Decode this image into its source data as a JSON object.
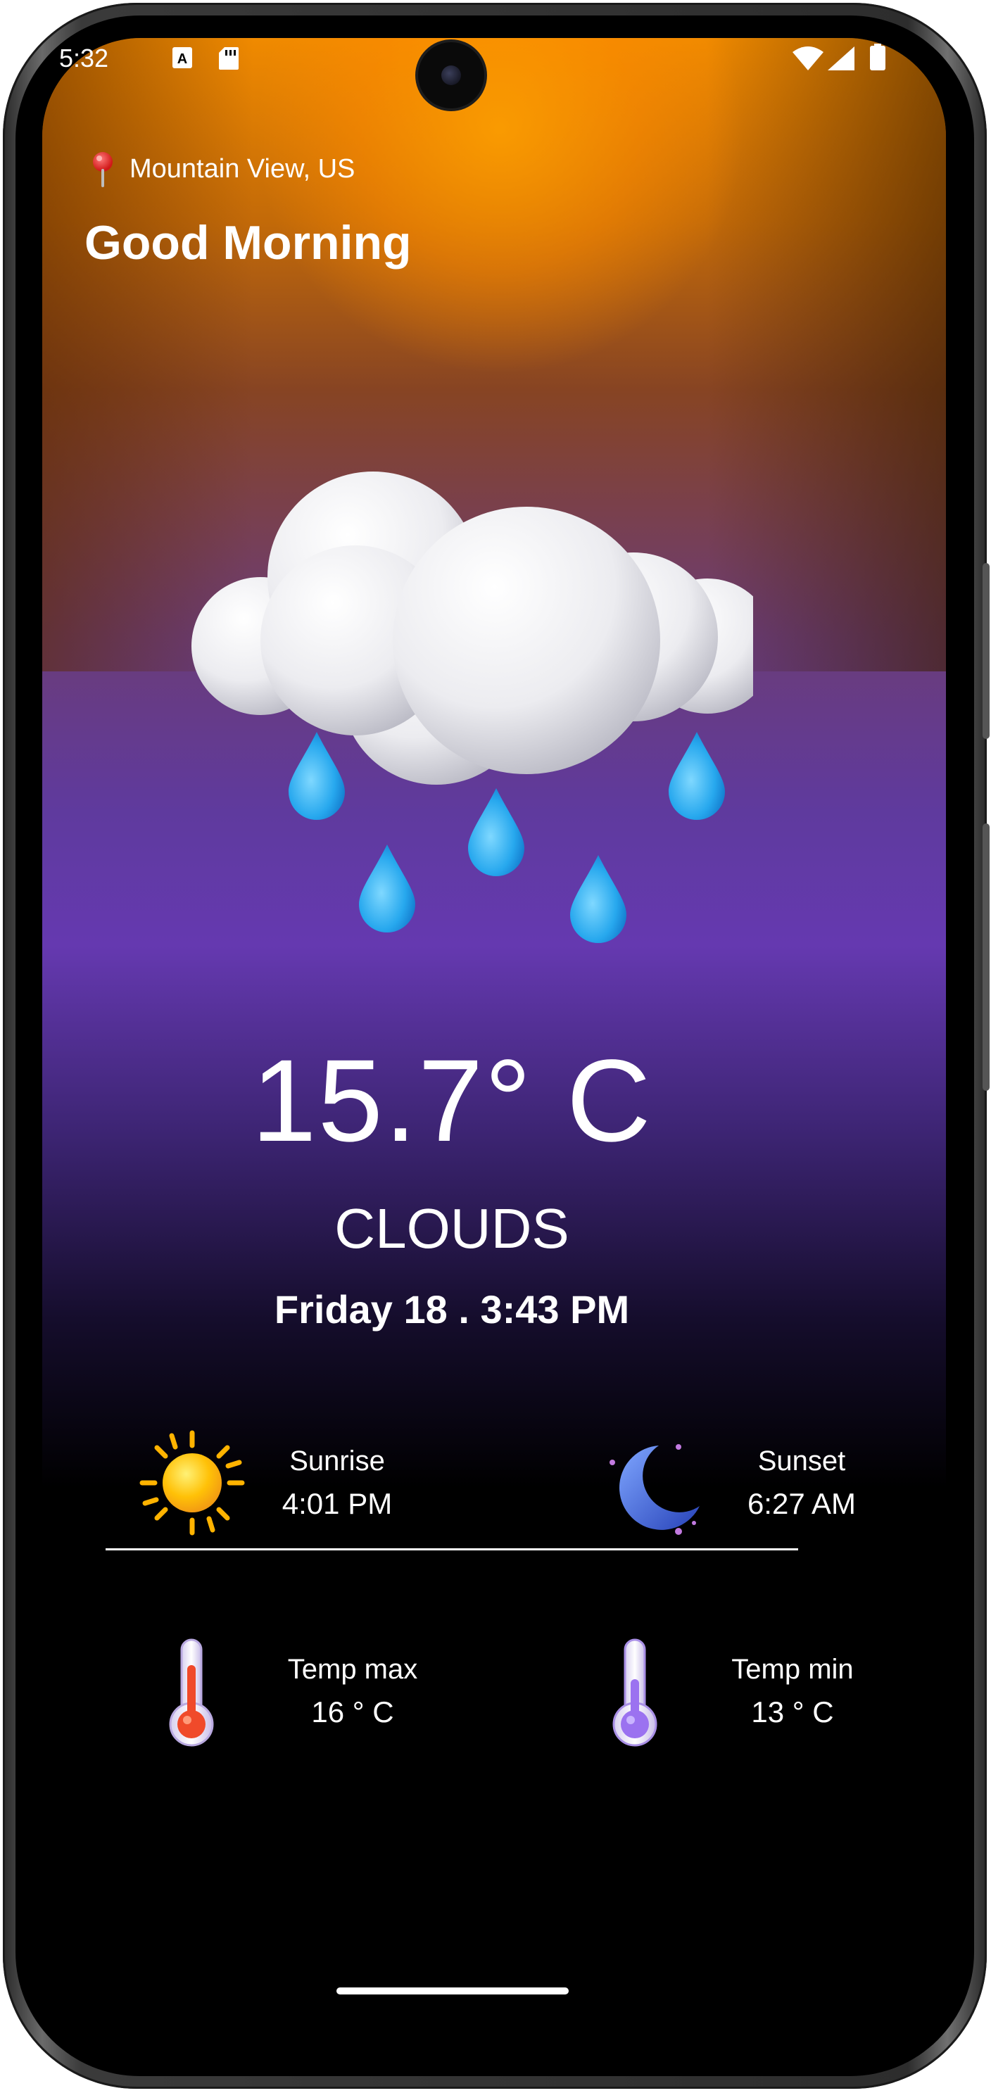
{
  "status_bar": {
    "time": "5:32",
    "icons": [
      "font-notification-icon",
      "sd-card-icon",
      "wifi-icon",
      "cell-signal-icon",
      "battery-icon"
    ]
  },
  "location": {
    "label": "Mountain View, US",
    "icon": "location-pin-icon"
  },
  "greeting": "Good Morning",
  "weather": {
    "illustration": "rain-cloud-icon",
    "temperature": "15.7° C",
    "condition": "CLOUDS",
    "datetime": "Friday 18 . 3:43 PM"
  },
  "sun": {
    "sunrise_label": "Sunrise",
    "sunrise_value": "4:01 PM",
    "sunset_label": "Sunset",
    "sunset_value": "6:27 AM"
  },
  "temps": {
    "max_label": "Temp max",
    "max_value": "16 ° C",
    "min_label": "Temp min",
    "min_value": "13 ° C"
  },
  "colors": {
    "top_orange": "#f08a00",
    "mid_purple": "#6539b0",
    "bottom": "#000000",
    "text": "#ffffff"
  }
}
